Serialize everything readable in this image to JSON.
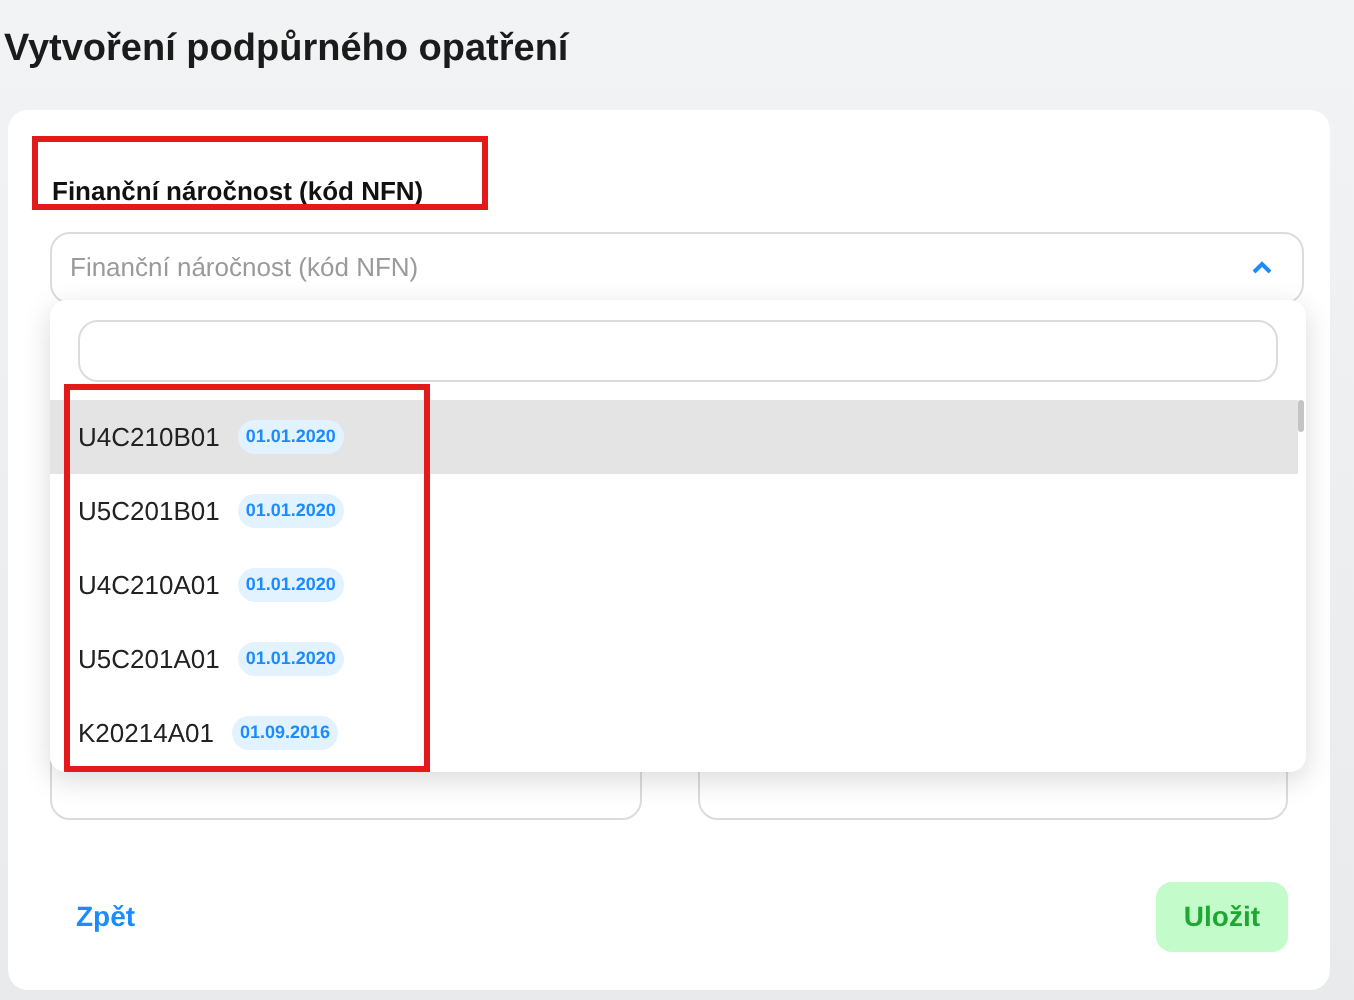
{
  "title": "Vytvoření podpůrného opatření",
  "field": {
    "label": "Finanční náročnost (kód NFN)",
    "label_highlighted": true,
    "placeholder": "Finanční náročnost (kód NFN)",
    "expanded": true
  },
  "dropdown": {
    "options_highlighted": true,
    "options": [
      {
        "code": "U4C210B01",
        "date": "01.01.2020",
        "selected": true
      },
      {
        "code": "U5C201B01",
        "date": "01.01.2020",
        "selected": false
      },
      {
        "code": "U4C210A01",
        "date": "01.01.2020",
        "selected": false
      },
      {
        "code": "U5C201A01",
        "date": "01.01.2020",
        "selected": false
      },
      {
        "code": "K20214A01",
        "date": "01.09.2016",
        "selected": false
      }
    ]
  },
  "back_link": "Zpět",
  "save_button": {
    "label": "Uložit",
    "disabled": true
  }
}
